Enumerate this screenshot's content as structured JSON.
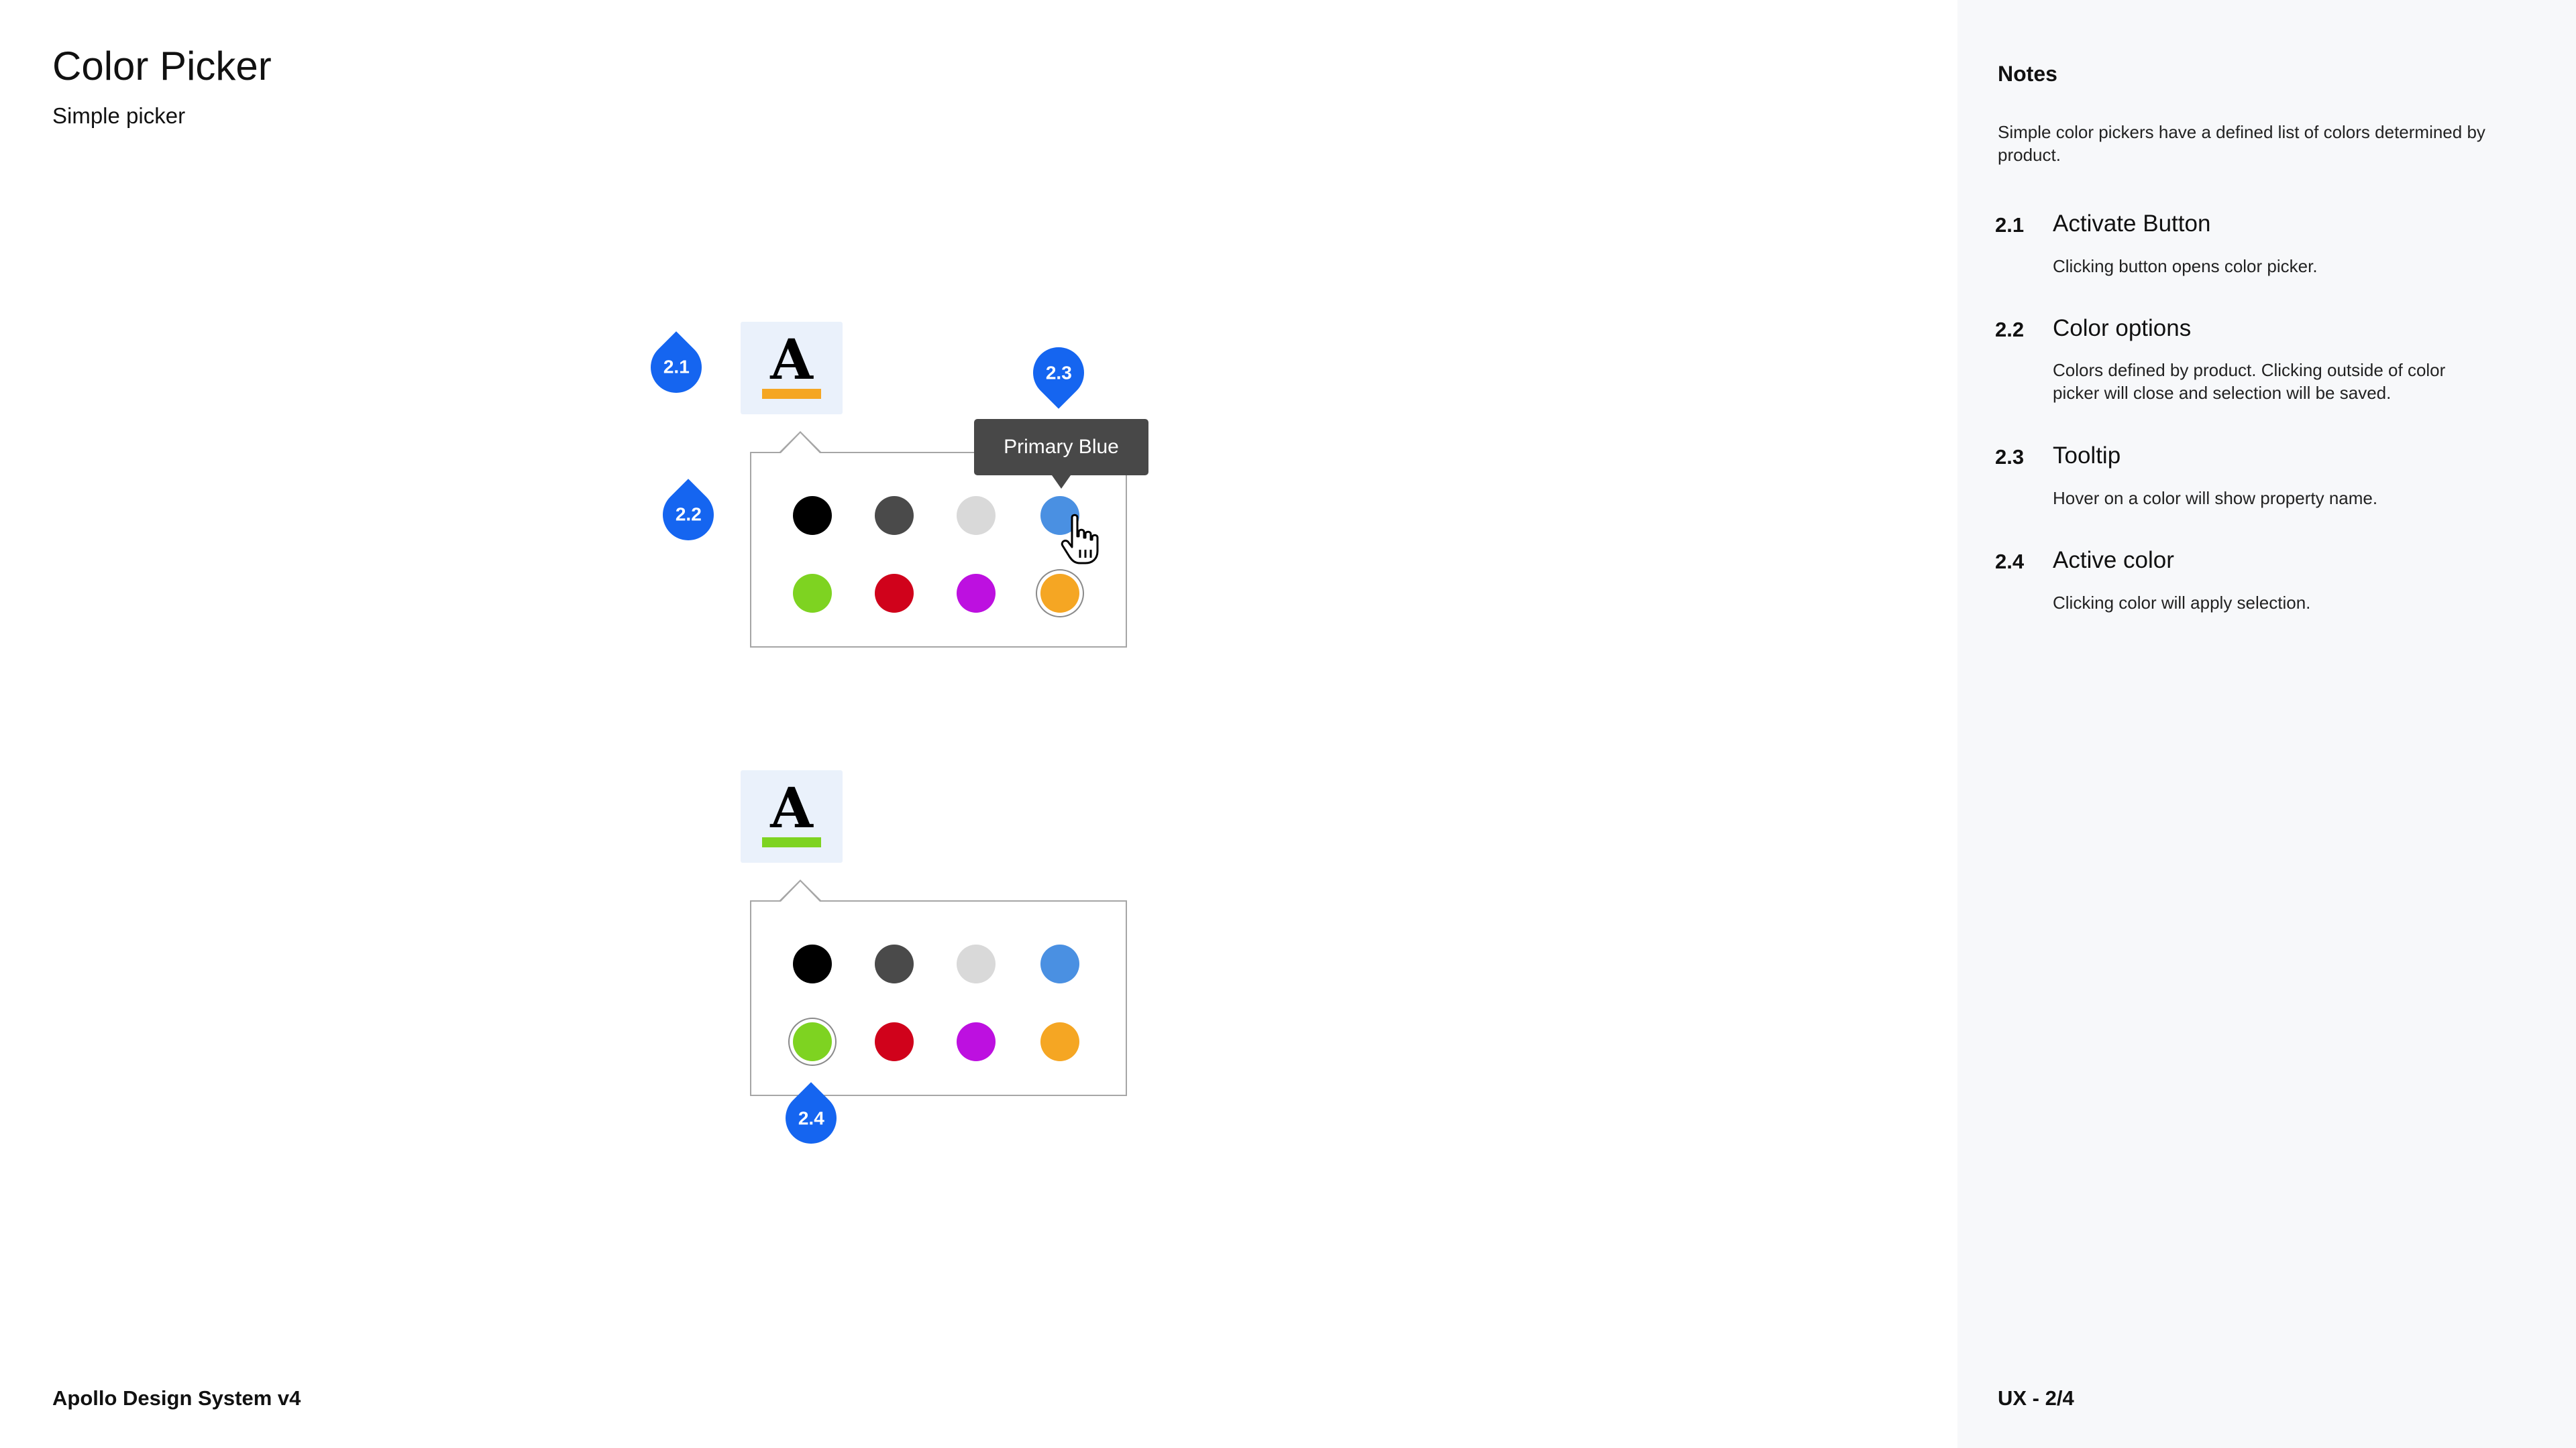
{
  "header": {
    "title": "Color Picker",
    "subtitle": "Simple picker"
  },
  "footer": {
    "left": "Apollo Design System v4",
    "right": "UX - 2/4"
  },
  "notes": {
    "title": "Notes",
    "intro": "Simple color pickers have a defined list of colors determined by product.",
    "items": [
      {
        "num": "2.1",
        "heading": "Activate Button",
        "desc": "Clicking button opens color picker."
      },
      {
        "num": "2.2",
        "heading": "Color options",
        "desc": "Colors defined by product.  Clicking outside of color picker will close and selection will be saved."
      },
      {
        "num": "2.3",
        "heading": "Tooltip",
        "desc": "Hover on a color will show property name."
      },
      {
        "num": "2.4",
        "heading": "Active color",
        "desc": "Clicking color will apply selection."
      }
    ]
  },
  "palette": [
    "#000000",
    "#4a4a4a",
    "#d9d9d9",
    "#4a90e2",
    "#7ed321",
    "#d0021b",
    "#bd10e0",
    "#f5a623"
  ],
  "examples": [
    {
      "button_glyph": "A",
      "underline_color": "#f5a623",
      "active_index": 7
    },
    {
      "button_glyph": "A",
      "underline_color": "#7ed321",
      "active_index": 4
    }
  ],
  "tooltip": {
    "text": "Primary Blue"
  },
  "markers": {
    "m21": "2.1",
    "m22": "2.2",
    "m23": "2.3",
    "m24": "2.4"
  },
  "icons": {
    "cursor": "hand-pointer-icon"
  }
}
